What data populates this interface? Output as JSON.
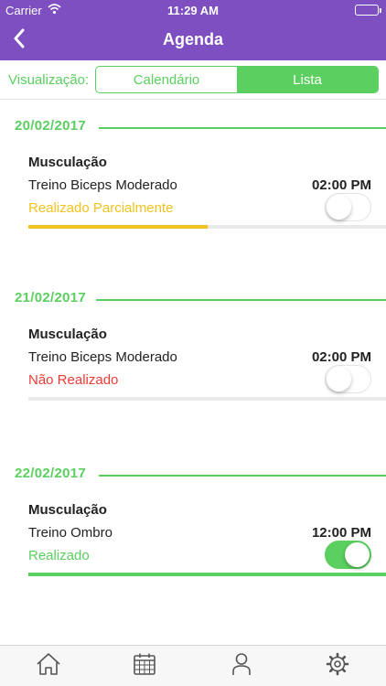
{
  "status_bar": {
    "carrier": "Carrier",
    "time": "11:29 AM",
    "wifi_icon": "wifi-icon",
    "battery_icon": "battery-icon"
  },
  "nav": {
    "title": "Agenda",
    "back_icon": "chevron-left-icon"
  },
  "view_switch": {
    "label": "Visualização:",
    "options": [
      "Calendário",
      "Lista"
    ],
    "selected": "Lista"
  },
  "agenda": [
    {
      "date": "20/02/2017",
      "category": "Musculação",
      "workout": "Treino Biceps Moderado",
      "time": "02:00 PM",
      "status": "Realizado Parcialmente",
      "status_color": "#f2c31d",
      "toggle_on": false,
      "progress_percent": 50,
      "progress_color": "#f2c31d"
    },
    {
      "date": "21/02/2017",
      "category": "Musculação",
      "workout": "Treino Biceps Moderado",
      "time": "02:00 PM",
      "status": "Não Realizado",
      "status_color": "#ee3b36",
      "toggle_on": false,
      "progress_percent": 0,
      "progress_color": "#e9e9e9"
    },
    {
      "date": "22/02/2017",
      "category": "Musculação",
      "workout": "Treino Ombro",
      "time": "12:00 PM",
      "status": "Realizado",
      "status_color": "#5bcf5f",
      "toggle_on": true,
      "progress_percent": 100,
      "progress_color": "#5bcf5f"
    }
  ],
  "tabs": [
    {
      "icon": "home-icon"
    },
    {
      "icon": "calendar-icon"
    },
    {
      "icon": "profile-icon"
    },
    {
      "icon": "gear-icon"
    }
  ],
  "colors": {
    "brand_purple": "#7d4fc0",
    "accent_green": "#5bcf5f"
  }
}
